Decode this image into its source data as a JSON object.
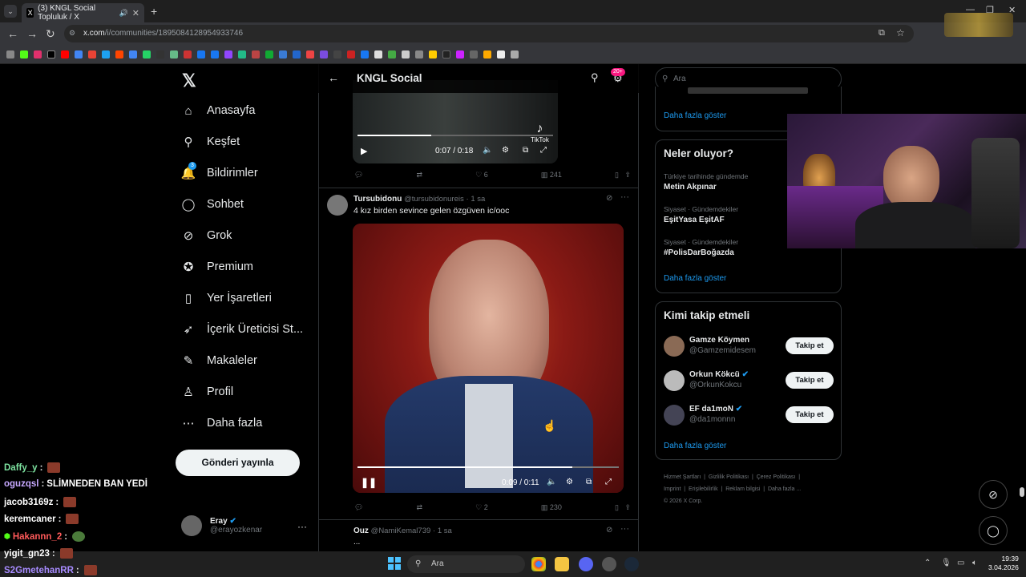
{
  "browser": {
    "tab_title": "(3) KNGL Social Topluluk / X",
    "new_tab": "+",
    "url_host": "x.com",
    "url_path": "/i/communities/1895084128954933746"
  },
  "nav": {
    "items": [
      {
        "label": "Anasayfa",
        "icon": "home-icon"
      },
      {
        "label": "Keşfet",
        "icon": "search-icon"
      },
      {
        "label": "Bildirimler",
        "icon": "bell-icon",
        "badge": "3"
      },
      {
        "label": "Sohbet",
        "icon": "chat-icon"
      },
      {
        "label": "Grok",
        "icon": "grok-icon"
      },
      {
        "label": "Premium",
        "icon": "premium-icon"
      },
      {
        "label": "Yer İşaretleri",
        "icon": "bookmark-icon"
      },
      {
        "label": "İçerik Üreticisi St...",
        "icon": "rocket-icon"
      },
      {
        "label": "Makaleler",
        "icon": "article-icon"
      },
      {
        "label": "Profil",
        "icon": "person-icon"
      },
      {
        "label": "Daha fazla",
        "icon": "more-circle-icon"
      }
    ],
    "post_button": "Gönderi yayınla",
    "user": {
      "name": "Eray",
      "handle": "@erayozkenar"
    }
  },
  "main": {
    "title": "KNGL Social",
    "notif_badge": "20+",
    "video1": {
      "time": "0:07 / 0:18",
      "watermark": "TikTok"
    },
    "post1_actions": {
      "likes": "6",
      "views": "241"
    },
    "post2": {
      "name": "Tursubidonu",
      "handle": "@tursubidonureis",
      "time": "· 1 sa",
      "text": "4 kız birden sevince gelen özgüven ic/ooc",
      "video_time": "0:09 / 0:11",
      "likes": "2",
      "views": "230"
    },
    "post3": {
      "name": "Ouz",
      "handle": "@NamiKemal739",
      "time": "· 1 sa",
      "text": "..."
    }
  },
  "right": {
    "search_placeholder": "Ara",
    "show_more_1": "Daha fazla göster",
    "trends_title": "Neler oluyor?",
    "trends": [
      {
        "category": "Türkiye tarihinde gündemde",
        "name": "Metin Akpınar"
      },
      {
        "category": "Siyaset · Gündemdekiler",
        "name": "EşitYasa EşitAF"
      },
      {
        "category": "Siyaset · Gündemdekiler",
        "name": "#PolisDarBoğazda"
      }
    ],
    "show_more_2": "Daha fazla göster",
    "follow_title": "Kimi takip etmeli",
    "follow": [
      {
        "name": "Gamze Köymen",
        "handle": "@Gamzemidesem",
        "verified": false
      },
      {
        "name": "Orkun Kökcü",
        "handle": "@OrkunKokcu",
        "verified": true
      },
      {
        "name": "EF da1moN",
        "handle": "@da1monnn",
        "verified": true
      }
    ],
    "follow_button": "Takip et",
    "show_more_3": "Daha fazla göster",
    "footer": [
      "Hizmet Şartları",
      "Gizlilik Politikası",
      "Çerez Politikası",
      "Imprint",
      "Erişilebilirlik",
      "Reklam bilgisi",
      "Daha fazla ...",
      "© 2026 X Corp."
    ]
  },
  "chat": [
    {
      "user": "Daffy_y",
      "msg": "",
      "color": "#7de3a0"
    },
    {
      "user": "oguzqsl",
      "msg": "SLİMNEDEN BAN YEDİ",
      "color": "#c7a8ff"
    },
    {
      "user": "jacob3169z",
      "msg": "",
      "color": "#ffffff"
    },
    {
      "user": "keremcaner",
      "msg": "",
      "color": "#ffffff"
    },
    {
      "user": "Hakannn_2",
      "msg": "",
      "color": "#ff5a5a"
    },
    {
      "user": "yigit_gn23",
      "msg": "",
      "color": "#ffffff"
    },
    {
      "user": "S2GmetehanRR",
      "msg": "",
      "color": "#a78bff"
    }
  ],
  "taskbar": {
    "search": "Ara",
    "time": "19:39",
    "date": "3.04.2026"
  }
}
